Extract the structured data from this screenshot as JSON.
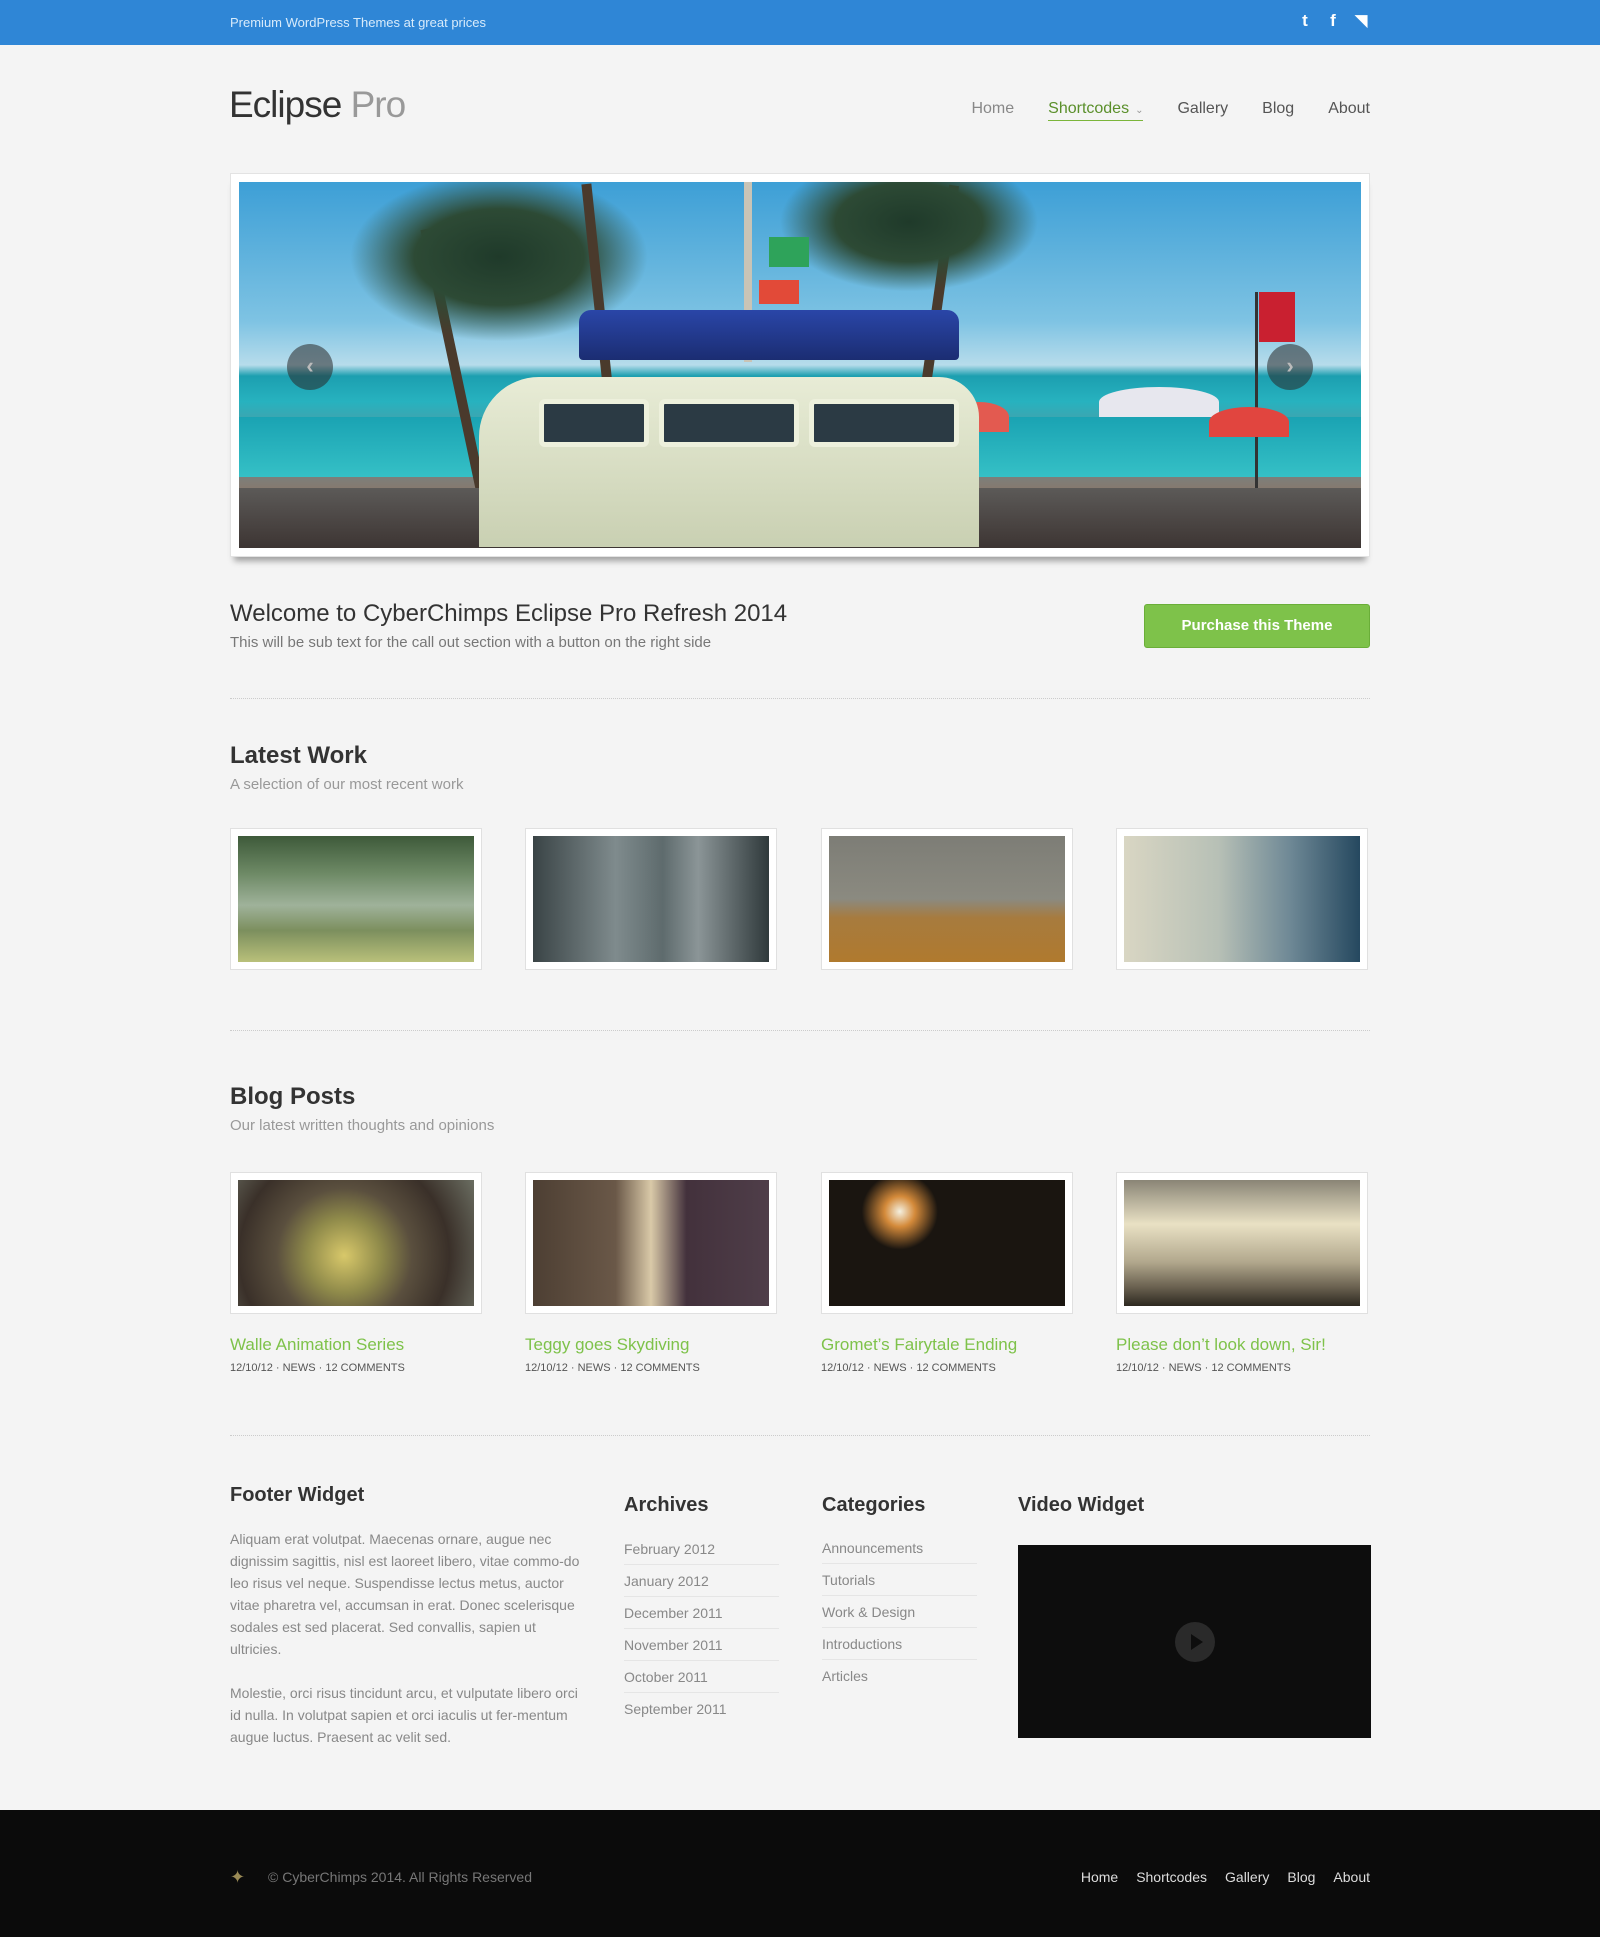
{
  "topbar": {
    "tagline": "Premium WordPress Themes at great prices",
    "social": [
      {
        "icon": "twitter-icon",
        "glyph": "t"
      },
      {
        "icon": "facebook-icon",
        "glyph": "f"
      },
      {
        "icon": "rss-icon",
        "glyph": "◥"
      }
    ],
    "color": "#2f86d6"
  },
  "header": {
    "logo_main": "Eclipse",
    "logo_sub": "Pro",
    "nav": [
      "Home",
      "Shortcodes",
      "Gallery",
      "Blog",
      "About"
    ],
    "active_nav": "Shortcodes"
  },
  "slider": {
    "prev_glyph": "‹",
    "next_glyph": "›"
  },
  "callout": {
    "title": "Welcome to CyberChimps Eclipse Pro Refresh 2014",
    "subtitle": "This will be sub text for the call out section with a button on the right side",
    "button": "Purchase this Theme",
    "button_color": "#7ec24a"
  },
  "latest_work": {
    "title": "Latest Work",
    "subtitle": "A selection of our most recent work"
  },
  "blog": {
    "title": "Blog Posts",
    "subtitle": "Our latest written thoughts and opinions",
    "posts": [
      {
        "title": "Walle Animation Series",
        "date": "12/10/12",
        "category": "NEWS",
        "comments": "12 COMMENTS"
      },
      {
        "title": "Teggy goes Skydiving",
        "date": "12/10/12",
        "category": "NEWS",
        "comments": "12 COMMENTS"
      },
      {
        "title": "Gromet’s Fairytale Ending",
        "date": "12/10/12",
        "category": "NEWS",
        "comments": "12 COMMENTS"
      },
      {
        "title": "Please don’t look down, Sir!",
        "date": "12/10/12",
        "category": "NEWS",
        "comments": "12 COMMENTS"
      }
    ],
    "accent": "#7ec24a"
  },
  "footer_widgets": {
    "about": {
      "title": "Footer Widget",
      "p1": "Aliquam erat volutpat. Maecenas ornare, augue nec dignissim sagittis, nisl est laoreet libero, vitae commo-do leo risus vel neque. Suspendisse lectus metus, auctor vitae pharetra vel, accumsan in erat. Donec scelerisque sodales est sed placerat. Sed convallis, sapien ut ultricies.",
      "p2": "Molestie, orci risus tincidunt arcu, et vulputate libero orci id nulla. In volutpat sapien et orci iaculis ut fer-mentum augue luctus. Praesent ac velit sed."
    },
    "archives": {
      "title": "Archives",
      "items": [
        "February 2012",
        "January 2012",
        "December 2011",
        "November 2011",
        "October 2011",
        "September 2011"
      ]
    },
    "categories": {
      "title": "Categories",
      "items": [
        "Announcements",
        "Tutorials",
        "Work & Design",
        "Introductions",
        "Articles"
      ]
    },
    "video": {
      "title": "Video Widget"
    }
  },
  "footer": {
    "copyright": "© CyberChimps 2014. All Rights Reserved",
    "nav": [
      "Home",
      "Shortcodes",
      "Gallery",
      "Blog",
      "About"
    ]
  }
}
